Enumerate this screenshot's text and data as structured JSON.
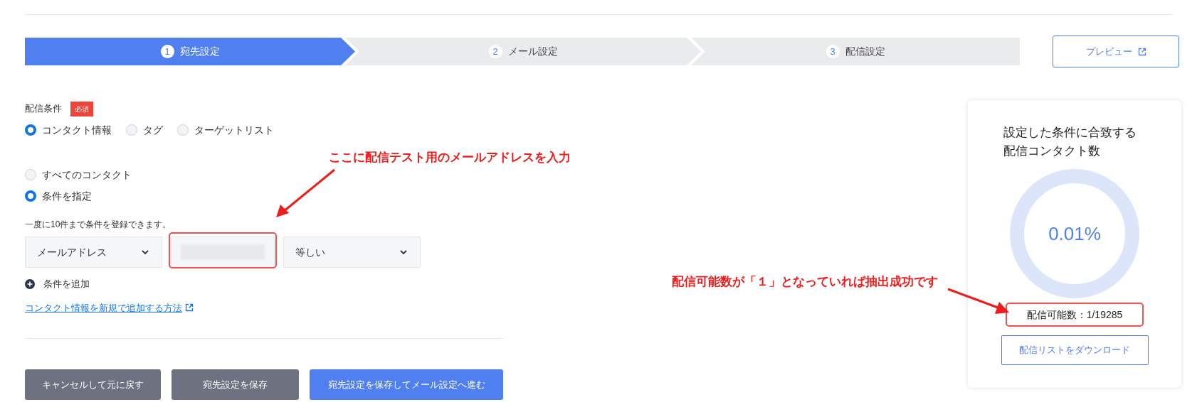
{
  "steps": [
    {
      "number": "1",
      "label": "宛先設定",
      "selected": true
    },
    {
      "number": "2",
      "label": "メール設定",
      "selected": false
    },
    {
      "number": "3",
      "label": "配信設定",
      "selected": false
    }
  ],
  "preview_button": "プレビュー",
  "condition": {
    "label": "配信条件",
    "badge": "必須",
    "source_options": [
      {
        "label": "コンタクト情報",
        "selected": true
      },
      {
        "label": "タグ",
        "selected": false
      },
      {
        "label": "ターゲットリスト",
        "selected": false
      }
    ],
    "scope_options": [
      {
        "label": "すべてのコンタクト",
        "selected": false
      },
      {
        "label": "条件を指定",
        "selected": true
      }
    ],
    "hint": "一度に10件まで条件を登録できます。",
    "field_select": "メールアドレス",
    "operator_select": "等しい",
    "add_condition": "条件を追加",
    "help_link": "コンタクト情報を新規で追加する方法"
  },
  "buttons": [
    {
      "label": "キャンセルして元に戻す",
      "kind": "secondary"
    },
    {
      "label": "宛先設定を保存",
      "kind": "secondary"
    },
    {
      "label": "宛先設定を保存してメール設定へ進む",
      "kind": "primary"
    }
  ],
  "summary": {
    "title_lines": [
      "設定した条件に合致する",
      "配信コンタクト数"
    ],
    "percent": "0.01%",
    "reading": "配信可能数：1/19285",
    "download_button": "配信リストをダウンロード"
  },
  "annotations": [
    {
      "text": "ここに配信テスト用のメールアドレスを入力"
    },
    {
      "text": "配信可能数が「１」となっていれば抽出成功です"
    }
  ]
}
